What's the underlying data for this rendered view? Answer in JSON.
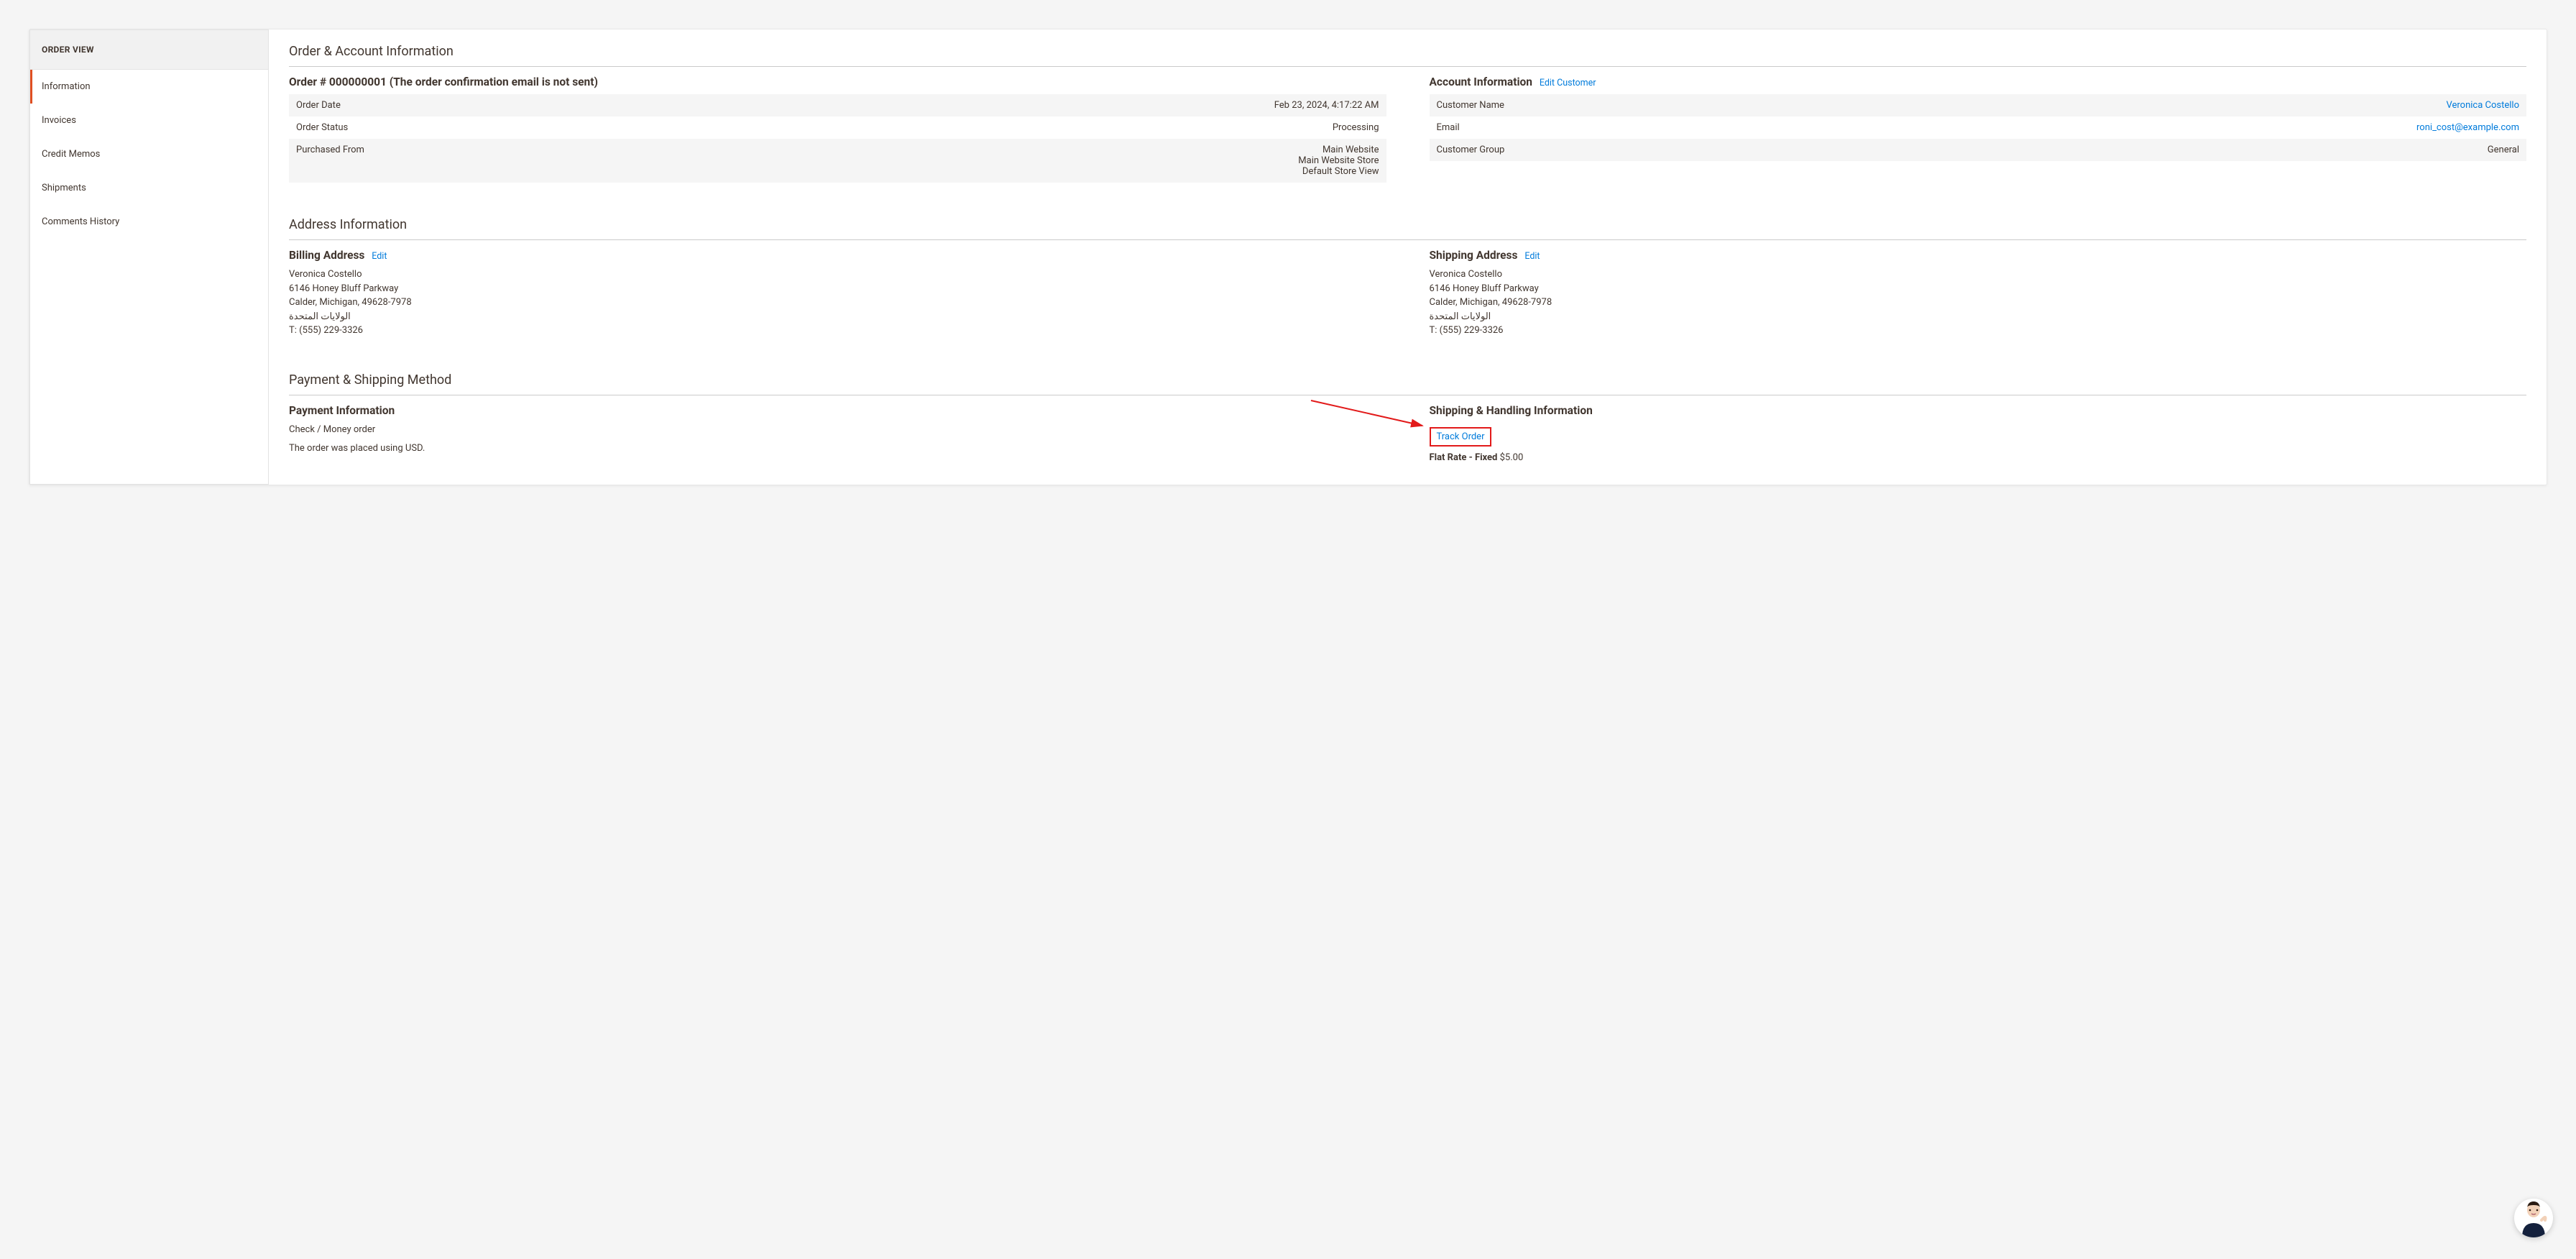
{
  "sidebar": {
    "title": "ORDER VIEW",
    "items": [
      {
        "label": "Information",
        "active": true
      },
      {
        "label": "Invoices",
        "active": false
      },
      {
        "label": "Credit Memos",
        "active": false
      },
      {
        "label": "Shipments",
        "active": false
      },
      {
        "label": "Comments History",
        "active": false
      }
    ]
  },
  "order_account": {
    "section_title": "Order & Account Information",
    "order_heading": "Order # 000000001 (The order confirmation email is not sent)",
    "order_rows": {
      "order_date_k": "Order Date",
      "order_date_v": "Feb 23, 2024, 4:17:22 AM",
      "order_status_k": "Order Status",
      "order_status_v": "Processing",
      "purchased_from_k": "Purchased From",
      "purchased_from_v1": "Main Website",
      "purchased_from_v2": "Main Website Store",
      "purchased_from_v3": "Default Store View"
    },
    "account_heading": "Account Information",
    "edit_customer": "Edit Customer",
    "account_rows": {
      "customer_name_k": "Customer Name",
      "customer_name_v": "Veronica Costello",
      "email_k": "Email",
      "email_v": "roni_cost@example.com",
      "customer_group_k": "Customer Group",
      "customer_group_v": "General"
    }
  },
  "address": {
    "section_title": "Address Information",
    "billing_heading": "Billing Address",
    "shipping_heading": "Shipping Address",
    "edit_label": "Edit",
    "billing": {
      "name": "Veronica Costello",
      "street": "6146 Honey Bluff Parkway",
      "city": "Calder, Michigan, 49628-7978",
      "country": "الولايات المتحدة",
      "phone": "T: (555) 229-3326"
    },
    "shipping": {
      "name": "Veronica Costello",
      "street": "6146 Honey Bluff Parkway",
      "city": "Calder, Michigan, 49628-7978",
      "country": "الولايات المتحدة",
      "phone": "T: (555) 229-3326"
    }
  },
  "payment_shipping": {
    "section_title": "Payment & Shipping Method",
    "payment_heading": "Payment Information",
    "payment_method": "Check / Money order",
    "currency_note": "The order was placed using USD.",
    "shipping_heading": "Shipping & Handling Information",
    "track_order": "Track Order",
    "flat_rate_label": "Flat Rate - Fixed",
    "flat_rate_price": "$5.00"
  }
}
